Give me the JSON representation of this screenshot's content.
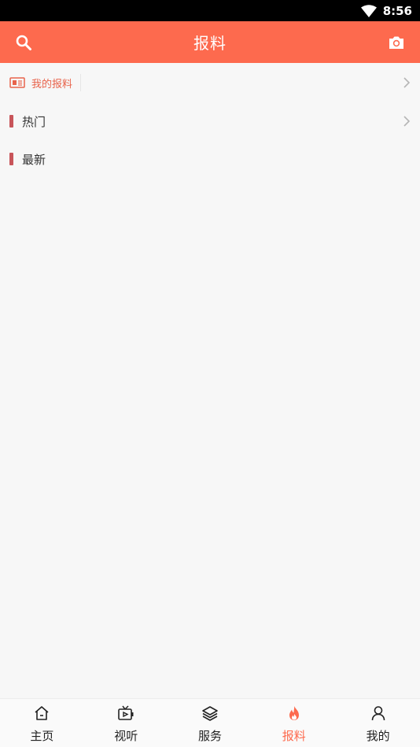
{
  "status_bar": {
    "time": "8:56"
  },
  "header": {
    "title": "报料"
  },
  "my_reports": {
    "label": "我的报料"
  },
  "sections": {
    "hot": "热门",
    "latest": "最新"
  },
  "bottom_nav": {
    "items": [
      {
        "label": "主页",
        "icon": "home-icon"
      },
      {
        "label": "视听",
        "icon": "tv-icon"
      },
      {
        "label": "服务",
        "icon": "layers-icon"
      },
      {
        "label": "报料",
        "icon": "flame-icon",
        "active": true
      },
      {
        "label": "我的",
        "icon": "user-icon"
      }
    ]
  },
  "colors": {
    "accent": "#fd6a4e",
    "section_bar": "#c8555a",
    "background": "#f7f7f7"
  }
}
